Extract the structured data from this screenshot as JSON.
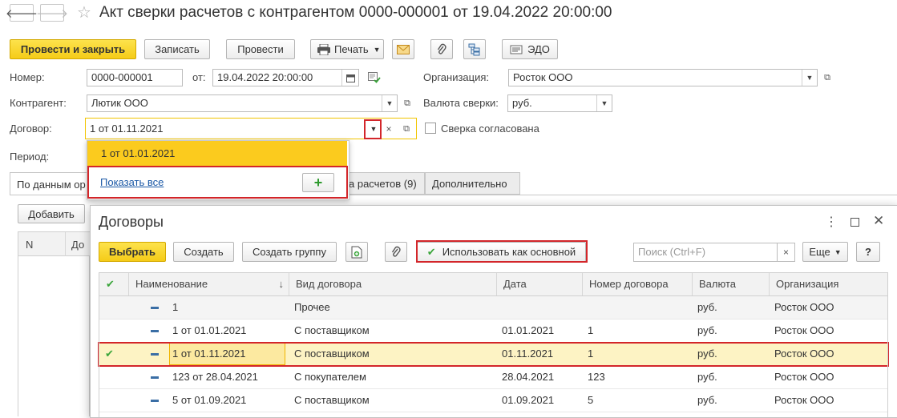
{
  "window": {
    "title": "Акт сверки расчетов с контрагентом 0000-000001 от 19.04.2022 20:00:00",
    "back_glyph": "🡐",
    "forward_glyph": "🡒",
    "star_glyph": "☆"
  },
  "toolbar": {
    "post_close": "Провести и закрыть",
    "save": "Записать",
    "post": "Провести",
    "print": "Печать",
    "edo": "ЭДО"
  },
  "form": {
    "number_label": "Номер:",
    "number_value": "0000-000001",
    "date_label": "от:",
    "date_value": "19.04.2022 20:00:00",
    "org_label": "Организация:",
    "org_value": "Росток ООО",
    "counterparty_label": "Контрагент:",
    "counterparty_value": "Лютик ООО",
    "currency_label": "Валюта сверки:",
    "currency_value": "руб.",
    "contract_label": "Договор:",
    "contract_value": "1 от 01.11.2021",
    "agreed_label": "Сверка согласована",
    "period_label": "Период:"
  },
  "dropdown": {
    "item": "1 от 01.01.2021",
    "show_all": "Показать все",
    "plus": "+"
  },
  "tabs": {
    "tab1": "По данным ор",
    "tab2": "а расчетов (9)",
    "tab3": "Дополнительно"
  },
  "background_panel": {
    "add_button": "Добавить",
    "col_n": "N",
    "col_do": "До"
  },
  "dialog": {
    "title": "Договоры",
    "select": "Выбрать",
    "create": "Создать",
    "create_group": "Создать группу",
    "use_as_main": "Использовать как основной",
    "search_placeholder": "Поиск (Ctrl+F)",
    "more": "Еще",
    "help": "?",
    "columns": [
      "Наименование",
      "Вид договора",
      "Дата",
      "Номер договора",
      "Валюта",
      "Организация"
    ],
    "sort_glyph": "↓",
    "rows": [
      {
        "name": "1",
        "kind": "Прочее",
        "date": "",
        "number": "",
        "currency": "руб.",
        "org": "Росток ООО"
      },
      {
        "name": "1 от 01.01.2021",
        "kind": "С поставщиком",
        "date": "01.01.2021",
        "number": "1",
        "currency": "руб.",
        "org": "Росток ООО"
      },
      {
        "name": "1 от 01.11.2021",
        "kind": "С поставщиком",
        "date": "01.11.2021",
        "number": "1",
        "currency": "руб.",
        "org": "Росток ООО"
      },
      {
        "name": "123 от 28.04.2021",
        "kind": "С покупателем",
        "date": "28.04.2021",
        "number": "123",
        "currency": "руб.",
        "org": "Росток ООО"
      },
      {
        "name": "5 от 01.09.2021",
        "kind": "С поставщиком",
        "date": "01.09.2021",
        "number": "5",
        "currency": "руб.",
        "org": "Росток ООО"
      }
    ]
  },
  "colors": {
    "accent_yellow": "#f5cc18",
    "highlight_red": "#d3262a",
    "selected_row": "#fdf3c4",
    "link_blue": "#1a58a6"
  }
}
